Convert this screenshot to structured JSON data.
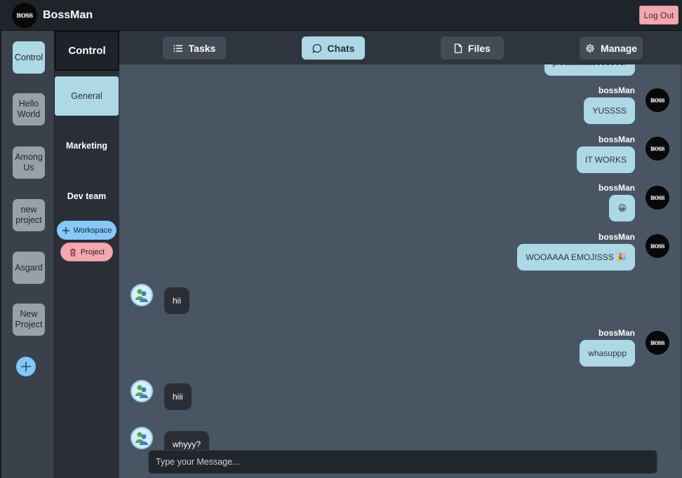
{
  "app": {
    "name": "BossMan",
    "logo_text": "BOSS",
    "logout_label": "Log Out"
  },
  "projects": [
    {
      "label": "Control",
      "active": true
    },
    {
      "label": "Hello World",
      "active": false
    },
    {
      "label": "Among Us",
      "active": false
    },
    {
      "label": "new project",
      "active": false
    },
    {
      "label": "Asgard",
      "active": false
    },
    {
      "label": "New Project",
      "active": false
    }
  ],
  "channels": {
    "title": "Control",
    "items": [
      {
        "label": "General",
        "active": true
      },
      {
        "label": "Marketing",
        "active": false
      },
      {
        "label": "Dev team",
        "active": false
      }
    ],
    "add_workspace_label": "Workspace",
    "delete_project_label": "Project"
  },
  "nav": {
    "tasks": "Tasks",
    "chats": "Chats",
    "files": "Files",
    "manage": "Manage",
    "active": "chats"
  },
  "messages": {
    "partial_top": "pleaaaaaaseeeeee!",
    "items": [
      {
        "sender": "bossMan",
        "text": "YUSSSS",
        "outgoing": true
      },
      {
        "sender": "bossMan",
        "text": "IT WORKS",
        "outgoing": true
      },
      {
        "sender": "bossMan",
        "text": "😀",
        "outgoing": true
      },
      {
        "sender": "bossMan",
        "text": "WOOAAAA EMOJISSS 🎉",
        "outgoing": true
      },
      {
        "sender": "",
        "text": "hii",
        "outgoing": false
      },
      {
        "sender": "bossMan",
        "text": "whasuppp",
        "outgoing": true
      },
      {
        "sender": "",
        "text": "hiii",
        "outgoing": false
      },
      {
        "sender": "",
        "text": "whyyy?",
        "outgoing": false
      }
    ]
  },
  "composer": {
    "placeholder": "Type your Message...",
    "value": ""
  },
  "colors": {
    "accent": "#add8e6",
    "danger": "#f4a7b0",
    "add": "#84c9f8"
  }
}
